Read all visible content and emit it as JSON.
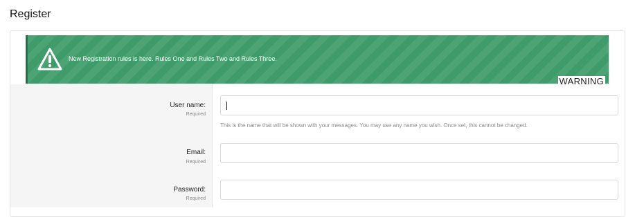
{
  "page": {
    "title": "Register"
  },
  "notice": {
    "message": "New Registration rules is here. Rules One and Rules Two and Rules Three.",
    "tag": "WARNING",
    "color": "#3f9c6a",
    "icon": "warning-triangle-icon"
  },
  "form": {
    "username": {
      "label": "User name:",
      "hint": "Required",
      "value": "",
      "explain": "This is the name that will be shown with your messages. You may use any name you wish. Once set, this cannot be changed."
    },
    "email": {
      "label": "Email:",
      "hint": "Required",
      "value": ""
    },
    "password": {
      "label": "Password:",
      "hint": "Required",
      "value": ""
    }
  }
}
